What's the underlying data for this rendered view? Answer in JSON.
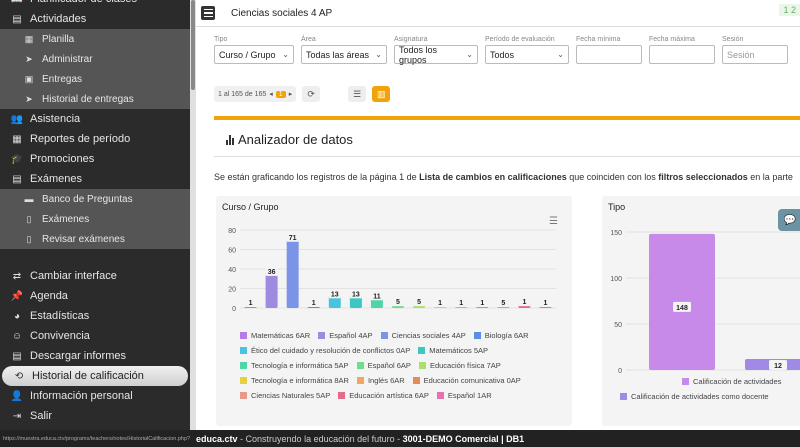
{
  "sidebar": {
    "items": [
      {
        "label": "Planificador de clases",
        "icon": "book-icon",
        "glyph": "📖",
        "sub": false
      },
      {
        "label": "Actividades",
        "icon": "clipboard-icon",
        "glyph": "▤",
        "sub": false
      },
      {
        "label": "Planilla",
        "icon": "grid-icon",
        "glyph": "▦",
        "sub": true
      },
      {
        "label": "Administrar",
        "icon": "send-icon",
        "glyph": "➤",
        "sub": true
      },
      {
        "label": "Entregas",
        "icon": "box-icon",
        "glyph": "▣",
        "sub": true
      },
      {
        "label": "Historial de entregas",
        "icon": "send-icon",
        "glyph": "➤",
        "sub": true
      },
      {
        "label": "Asistencia",
        "icon": "people-icon",
        "glyph": "👥",
        "sub": false
      },
      {
        "label": "Reportes de período",
        "icon": "calendar-icon",
        "glyph": "▦",
        "sub": false
      },
      {
        "label": "Promociones",
        "icon": "graduation-cap-icon",
        "glyph": "🎓",
        "sub": false
      },
      {
        "label": "Exámenes",
        "icon": "clipboard-icon",
        "glyph": "▤",
        "sub": false
      },
      {
        "label": "Banco de Preguntas",
        "icon": "folder-icon",
        "glyph": "▬",
        "sub": true
      },
      {
        "label": "Exámenes",
        "icon": "file-icon",
        "glyph": "▯",
        "sub": true
      },
      {
        "label": "Revisar exámenes",
        "icon": "file-icon",
        "glyph": "▯",
        "sub": true
      }
    ],
    "bottom_items": [
      {
        "label": "Cambiar interface",
        "icon": "exchange-icon",
        "glyph": "⇄",
        "active": false
      },
      {
        "label": "Agenda",
        "icon": "pin-icon",
        "glyph": "📌",
        "active": false
      },
      {
        "label": "Estadísticas",
        "icon": "pie-chart-icon",
        "glyph": "◕",
        "active": false
      },
      {
        "label": "Convivencia",
        "icon": "smile-icon",
        "glyph": "☺",
        "active": false
      },
      {
        "label": "Descargar informes",
        "icon": "file-download-icon",
        "glyph": "▤",
        "active": false
      },
      {
        "label": "Historial de calificación",
        "icon": "history-icon",
        "glyph": "⟲",
        "active": true
      },
      {
        "label": "Información personal",
        "icon": "user-icon",
        "glyph": "👤",
        "active": false
      },
      {
        "label": "Salir",
        "icon": "logout-icon",
        "glyph": "⇥",
        "active": false
      }
    ]
  },
  "header": {
    "course": "Ciencias sociales 4 AP",
    "pager": "1 2"
  },
  "filters": [
    {
      "label": "Tipo",
      "value": "Curso / Grupo",
      "dropdown": true,
      "width": 80
    },
    {
      "label": "Área",
      "value": "Todas las áreas",
      "dropdown": true,
      "width": 86
    },
    {
      "label": "Asignatura",
      "value": "Todos los grupos",
      "dropdown": true,
      "width": 84
    },
    {
      "label": "Período de evaluación",
      "value": "Todos",
      "dropdown": true,
      "width": 84
    },
    {
      "label": "Fecha mínima",
      "value": "",
      "dropdown": false,
      "width": 66
    },
    {
      "label": "Fecha máxima",
      "value": "",
      "dropdown": false,
      "width": 66
    },
    {
      "label": "Sesión",
      "value": "Sesión",
      "dropdown": false,
      "width": 66,
      "placeholder": true
    }
  ],
  "pager": {
    "range": "1 al 165 de 165",
    "page": "1"
  },
  "panel": {
    "title": "Analizador de datos",
    "desc_1": "Se están graficando los registros de la página 1 de ",
    "desc_bold_1": "Lista de cambios en calificaciones",
    "desc_2": " que coinciden con los ",
    "desc_bold_2": "filtros seleccionados",
    "desc_3": " en la parte"
  },
  "chart_data": [
    {
      "type": "bar",
      "title": "Curso / Grupo",
      "ylim": [
        0,
        80
      ],
      "yticks": [
        0,
        20,
        40,
        60,
        80
      ],
      "bars": [
        {
          "name": "Matemáticas 6AR",
          "color": "#b77ae6",
          "value": 1
        },
        {
          "name": "Español 4AP",
          "color": "#9e8be0",
          "value": 36
        },
        {
          "name": "Ciencias sociales 4AP",
          "color": "#7b94e8",
          "value": 71
        },
        {
          "name": "Biología 6AR",
          "color": "#5b8fe0",
          "value": 1
        },
        {
          "name": "Ético del cuidado y resolución de conflictos 0AP",
          "color": "#49c4e0",
          "value": 13
        },
        {
          "name": "Matemáticos 5AP",
          "color": "#3cc7c2",
          "value": 13
        },
        {
          "name": "Tecnología e informática 5AP",
          "color": "#50d6a6",
          "value": 11
        },
        {
          "name": "Español 6AP",
          "color": "#6fde8a",
          "value": 5
        },
        {
          "name": "Educación física 7AP",
          "color": "#a8e06a",
          "value": 5
        },
        {
          "name": "Tecnología e informática 8AR",
          "color": "#e6d040",
          "value": 1
        },
        {
          "name": "Inglés 6AR",
          "color": "#f0a860",
          "value": 1
        },
        {
          "name": "Educación comunicativa 0AP",
          "color": "#e68a5a",
          "value": 1
        },
        {
          "name": "Ciencias Naturales 5AP",
          "color": "#e89a8a",
          "value": 1
        },
        {
          "name": "Educación artística 6AP",
          "color": "#e46c8a",
          "value": 5
        },
        {
          "name": "Español 1AR",
          "color": "#e870b0",
          "value": 1
        }
      ],
      "labels_shown": [
        "1",
        "36",
        "71",
        "1",
        "13",
        "13",
        "11",
        "5",
        "5",
        "1",
        "1",
        "1",
        "5",
        "1",
        "1"
      ]
    },
    {
      "type": "bar",
      "title": "Tipo",
      "ylim": [
        0,
        150
      ],
      "yticks": [
        0,
        50,
        100,
        150
      ],
      "bars": [
        {
          "name": "Calificación de actividades",
          "color": "#c78ae8",
          "value": 148
        },
        {
          "name": "Calificación de actividades como docente",
          "color": "#a08ae6",
          "value": 12
        }
      ],
      "legend_visible": [
        "Calificación de actividades",
        "Calificación de actividades como docente"
      ]
    }
  ],
  "status": {
    "url": "https://muestra.educa.ctv/programs/teachers/notes/HistorialCalificacion.php?tabla=1&accion=...",
    "brand": "educa.ctv",
    "slogan": " - Construyendo la educación del futuro - ",
    "school": "3001-DEMO Comercial | DB1"
  }
}
